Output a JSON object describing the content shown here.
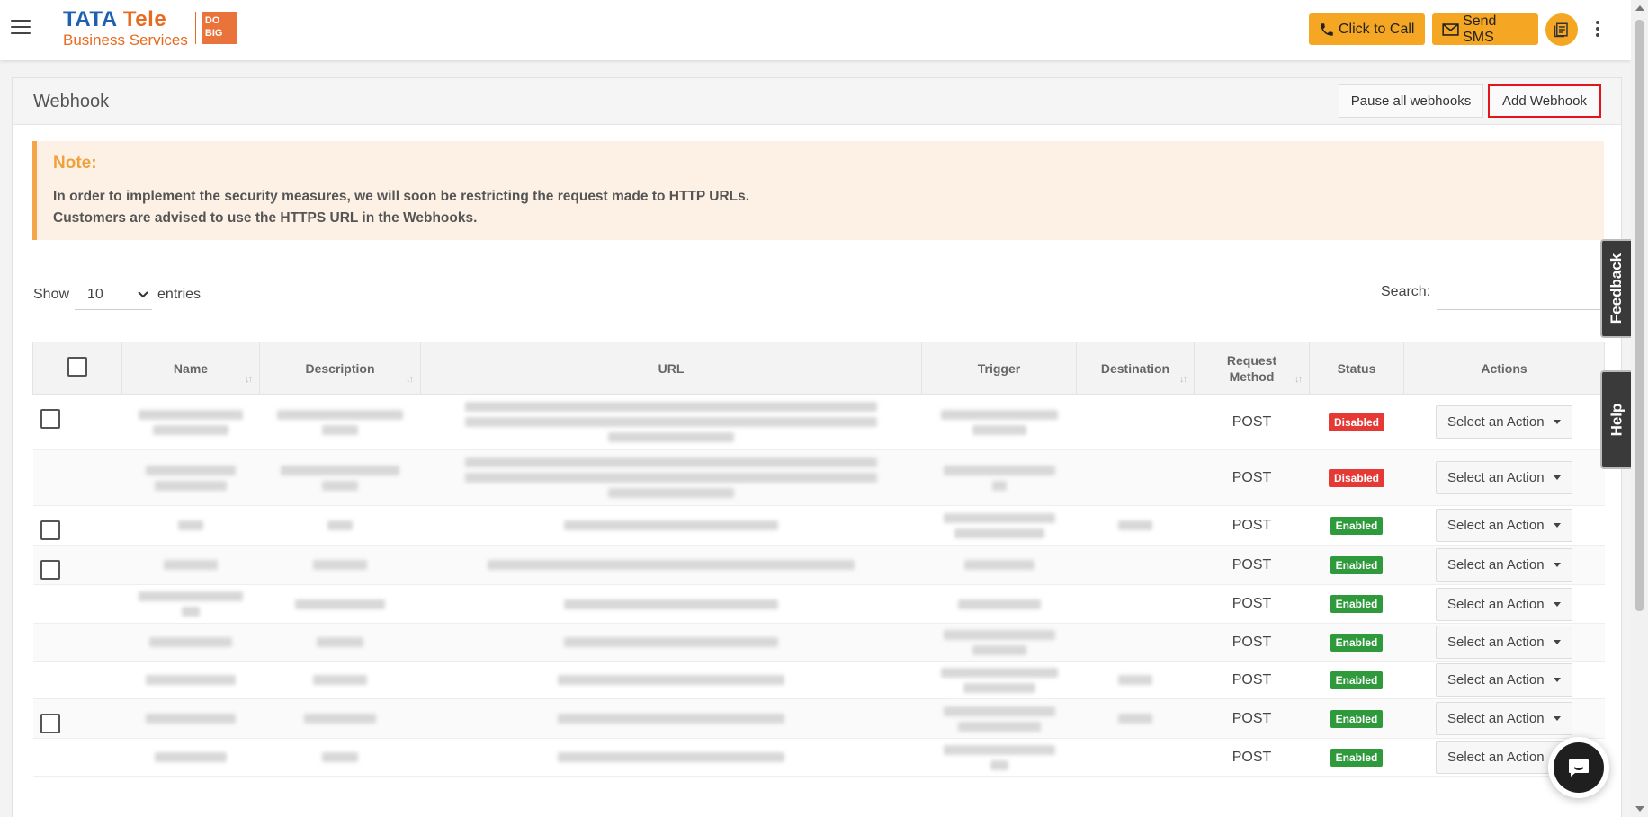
{
  "header": {
    "logo_brand": "TATA",
    "logo_brand2": "Tele",
    "logo_sub": "Business Services",
    "logo_badge_l1": "DO",
    "logo_badge_l2": "BIG",
    "call_label": "Click to Call",
    "sms_label": "Send SMS"
  },
  "page": {
    "title": "Webhook",
    "pause_label": "Pause all webhooks",
    "add_label": "Add Webhook"
  },
  "note": {
    "title": "Note:",
    "line1": "In order to implement the security measures, we will soon be restricting the request made to HTTP URLs.",
    "line2": "Customers are advised to use the HTTPS URL in the Webhooks."
  },
  "controls": {
    "show_label": "Show",
    "entries_value": "10",
    "entries_label": "entries",
    "search_label": "Search:",
    "search_value": ""
  },
  "table": {
    "columns": [
      "Name",
      "Description",
      "URL",
      "Trigger",
      "Destination",
      "Request Method",
      "Status",
      "Actions"
    ],
    "rows": [
      {
        "checkbox": true,
        "method": "POST",
        "status": "Disabled",
        "action": "Select an Action"
      },
      {
        "checkbox": false,
        "method": "POST",
        "status": "Disabled",
        "action": "Select an Action"
      },
      {
        "checkbox": true,
        "method": "POST",
        "status": "Enabled",
        "action": "Select an Action"
      },
      {
        "checkbox": true,
        "method": "POST",
        "status": "Enabled",
        "action": "Select an Action"
      },
      {
        "checkbox": false,
        "method": "POST",
        "status": "Enabled",
        "action": "Select an Action"
      },
      {
        "checkbox": false,
        "method": "POST",
        "status": "Enabled",
        "action": "Select an Action"
      },
      {
        "checkbox": false,
        "method": "POST",
        "status": "Enabled",
        "action": "Select an Action"
      },
      {
        "checkbox": true,
        "method": "POST",
        "status": "Enabled",
        "action": "Select an Action"
      },
      {
        "checkbox": false,
        "method": "POST",
        "status": "Enabled",
        "action": "Select an Action"
      }
    ]
  },
  "side": {
    "feedback_label": "Feedback",
    "help_label": "Help"
  },
  "colors": {
    "accent": "#f5a623",
    "disabled": "#e53935",
    "enabled": "#2e9a3c",
    "highlight": "#e3141c"
  }
}
